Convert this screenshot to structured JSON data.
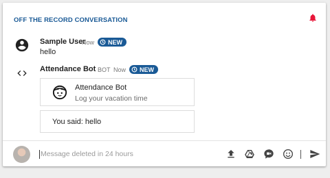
{
  "header": {
    "title": "OFF THE RECORD CONVERSATION"
  },
  "colors": {
    "accent": "#1a5a96",
    "bell": "#e8173a"
  },
  "messages": [
    {
      "sender": "Sample User",
      "time": "Now",
      "badge": "NEW",
      "text": "hello",
      "icon": "account-circle-icon"
    },
    {
      "sender": "Attendance Bot",
      "tag": "BOT",
      "time": "Now",
      "badge": "NEW",
      "icon": "code-icon",
      "card": {
        "title": "Attendance Bot",
        "subtitle": "Log your vacation time",
        "icon": "bot-face-icon"
      },
      "reply": "You said: hello"
    }
  ],
  "composer": {
    "placeholder": "Message deleted in 24 hours",
    "tools": [
      "upload-icon",
      "drive-icon",
      "video-icon",
      "emoji-icon",
      "send-icon"
    ]
  }
}
